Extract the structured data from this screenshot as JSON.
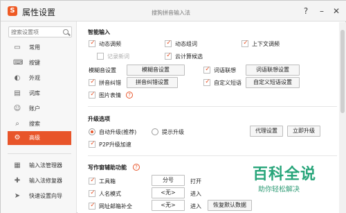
{
  "app": {
    "title": "属性设置",
    "subtitle": "搜狗拼音输入法"
  },
  "window_controls": {
    "help": "?",
    "min": "–",
    "close": "✕"
  },
  "search": {
    "placeholder": "搜索设置项"
  },
  "sidebar": {
    "items": [
      {
        "label": "常用",
        "icon": "monitor-icon"
      },
      {
        "label": "按键",
        "icon": "keyboard-icon"
      },
      {
        "label": "外观",
        "icon": "palette-icon"
      },
      {
        "label": "词库",
        "icon": "book-icon"
      },
      {
        "label": "账户",
        "icon": "user-icon"
      },
      {
        "label": "搜索",
        "icon": "search-icon"
      },
      {
        "label": "高级",
        "icon": "gear-icon",
        "active": true
      }
    ],
    "bottom_items": [
      {
        "label": "输入法管理器",
        "icon": "manager-icon"
      },
      {
        "label": "输入法修复器",
        "icon": "repair-icon"
      },
      {
        "label": "快速设置向导",
        "icon": "wizard-icon"
      }
    ]
  },
  "smart_input": {
    "title": "智能输入",
    "dynamic_freq": "动态调频",
    "dynamic_phrase": "动态组词",
    "context_freq": "上下文调频",
    "record_new_words": "记录新词",
    "cloud_candidates": "云计算候选",
    "fuzzy_sound": "模糊音设置",
    "fuzzy_sound_btn": "模糊音设置",
    "word_association": "词语联想",
    "word_association_btn": "词语联想设置",
    "pinyin_correct": "拼音纠错",
    "pinyin_correct_btn": "拼音纠错设置",
    "custom_phrase": "自定义短语",
    "custom_phrase_btn": "自定义短语设置",
    "picture_emoji": "图片表情"
  },
  "upgrade": {
    "title": "升级选项",
    "auto_upgrade": "自动升级(推荐)",
    "prompt_upgrade": "提示升级",
    "proxy_btn": "代理设置",
    "upgrade_now_btn": "立即升级",
    "p2p": "P2P升级加速"
  },
  "writing_assist": {
    "title": "写作窗辅助功能",
    "toolbox": "工具箱",
    "toolbox_key": "分号",
    "toolbox_action": "打开",
    "person_mode": "人名模式",
    "person_mode_key": "<无>",
    "person_mode_action": "进入",
    "url_email": "网址邮箱补全",
    "url_email_key": "<无>",
    "url_email_action": "进入",
    "restore_default": "恢复默认数据"
  },
  "watermark": {
    "line1": "百科全说",
    "line2": "助你轻松解决"
  },
  "colors": {
    "accent": "#e8552a",
    "watermark": "#28a57a"
  }
}
